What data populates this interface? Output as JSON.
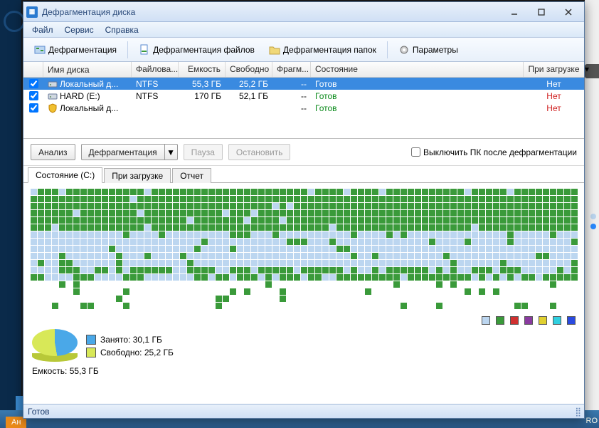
{
  "title": "Дефрагментация диска",
  "menu": {
    "file": "Файл",
    "service": "Сервис",
    "help": "Справка"
  },
  "toolbar": {
    "defrag": "Дефрагментация",
    "defrag_files": "Дефрагментация файлов",
    "defrag_folders": "Дефрагментация папок",
    "options": "Параметры"
  },
  "table": {
    "head": {
      "name": "Имя диска",
      "fs": "Файлова...",
      "cap": "Емкость",
      "free": "Свободно",
      "frag": "Фрагм...",
      "state": "Состояние",
      "boot": "При загрузке"
    },
    "rows": [
      {
        "name": "Локальный д...",
        "fs": "NTFS",
        "cap": "55,3 ГБ",
        "free": "25,2 ГБ",
        "frag": "--",
        "state": "Готов",
        "boot": "Нет",
        "selected": true,
        "checked": true,
        "icon": "drive"
      },
      {
        "name": "HARD (E:)",
        "fs": "NTFS",
        "cap": "170 ГБ",
        "free": "52,1 ГБ",
        "frag": "--",
        "state": "Готов",
        "boot": "Нет",
        "selected": false,
        "checked": true,
        "icon": "drive"
      },
      {
        "name": "Локальный д...",
        "fs": "",
        "cap": "",
        "free": "",
        "frag": "--",
        "state": "Готов",
        "boot": "Нет",
        "selected": false,
        "checked": true,
        "icon": "shield"
      }
    ]
  },
  "actions": {
    "analyze": "Анализ",
    "defrag": "Дефрагментация",
    "pause": "Пауза",
    "stop": "Остановить",
    "shutdown": "Выключить ПК после дефрагментации"
  },
  "tabs": {
    "state": "Состояние (C:)",
    "boot": "При загрузке",
    "report": "Отчет"
  },
  "legend": [
    "#bcd6f0",
    "#3a9a3a",
    "#d03030",
    "#8a3aa0",
    "#e0d030",
    "#30d0e0",
    "#2a4ae0"
  ],
  "summary": {
    "used_label": "Занято: 30,1 ГБ",
    "free_label": "Свободно: 25,2 ГБ",
    "capacity": "Емкость: 55,3 ГБ",
    "used_color": "#4aa8e8",
    "free_color": "#d8e858"
  },
  "status": "Готов",
  "bg": {
    "orange": "Ан",
    "ro": "RO"
  },
  "chart_data": {
    "type": "pie",
    "title": "Disk usage (C:)",
    "series": [
      {
        "name": "Занято",
        "value": 30.1,
        "unit": "ГБ",
        "color": "#4aa8e8"
      },
      {
        "name": "Свободно",
        "value": 25.2,
        "unit": "ГБ",
        "color": "#d8e858"
      }
    ],
    "total": {
      "label": "Емкость",
      "value": 55.3,
      "unit": "ГБ"
    }
  },
  "map": {
    "cols": 77,
    "rows": 17,
    "pattern": "rows 0-5 mostly green with a few blue cells; rows 6-10 mostly light-blue with sparse green; rows 11-12 mixed green/blue transition; rows 13-16 mostly white with scattered green"
  }
}
